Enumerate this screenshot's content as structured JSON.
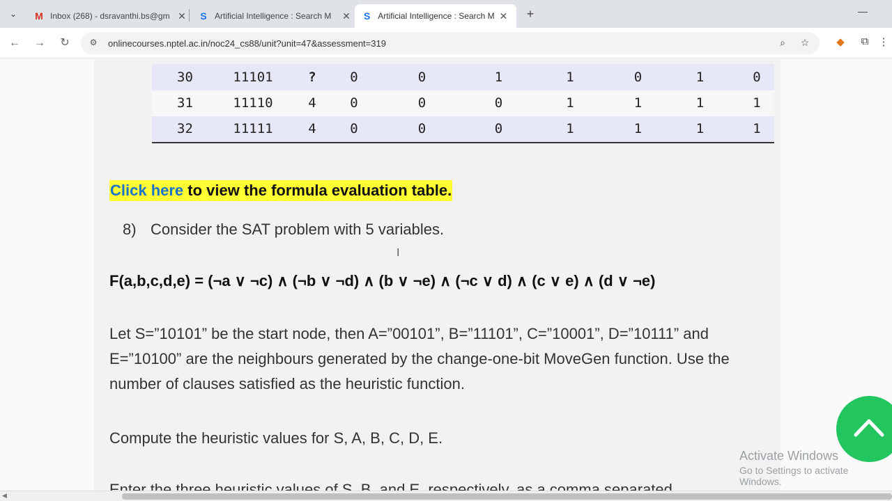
{
  "browser": {
    "tabs": [
      {
        "title": "Inbox (268) - dsravanthi.bs@gm",
        "favicon": "gmail-icon",
        "active": false
      },
      {
        "title": "Artificial Intelligence : Search M",
        "favicon": "swayam-icon",
        "active": false
      },
      {
        "title": "Artificial Intelligence : Search M",
        "favicon": "swayam-icon",
        "active": true
      }
    ],
    "url": "onlinecourses.nptel.ac.in/noc24_cs88/unit?unit=47&assessment=319"
  },
  "table": {
    "rows": [
      [
        "30",
        "11101",
        "?",
        "0",
        "0",
        "1",
        "1",
        "0",
        "1",
        "0"
      ],
      [
        "31",
        "11110",
        "4",
        "0",
        "0",
        "0",
        "1",
        "1",
        "1",
        "1"
      ],
      [
        "32",
        "11111",
        "4",
        "0",
        "0",
        "0",
        "1",
        "1",
        "1",
        "1"
      ]
    ]
  },
  "link": {
    "anchor": "Click here",
    "rest": " to view the formula evaluation table."
  },
  "question": {
    "number": "8)",
    "text": "Consider the SAT problem with 5 variables.",
    "formula": "F(a,b,c,d,e) = (¬a ∨ ¬c) ∧ (¬b ∨ ¬d) ∧ (b ∨ ¬e) ∧ (¬c ∨ d) ∧ (c ∨ e) ∧ (d ∨ ¬e)",
    "para1": "Let S=”10101” be the start node, then A=”00101”, B=”11101”, C=”10001”, D=”10111” and E=”10100” are the neighbours generated by the change-one-bit MoveGen function. Use the number of clauses satisfied as the heuristic function.",
    "para2": "Compute the heuristic values for S, A, B, C, D, E.",
    "para3": "Enter the three heuristic values of S, B, and E, respectively, as a comma separated"
  },
  "watermark": {
    "line1": "Activate Windows",
    "line2": "Go to Settings to activate Windows."
  },
  "colors": {
    "highlight": "#ffff33",
    "link": "#1a73c8",
    "fab": "#22c55e"
  }
}
